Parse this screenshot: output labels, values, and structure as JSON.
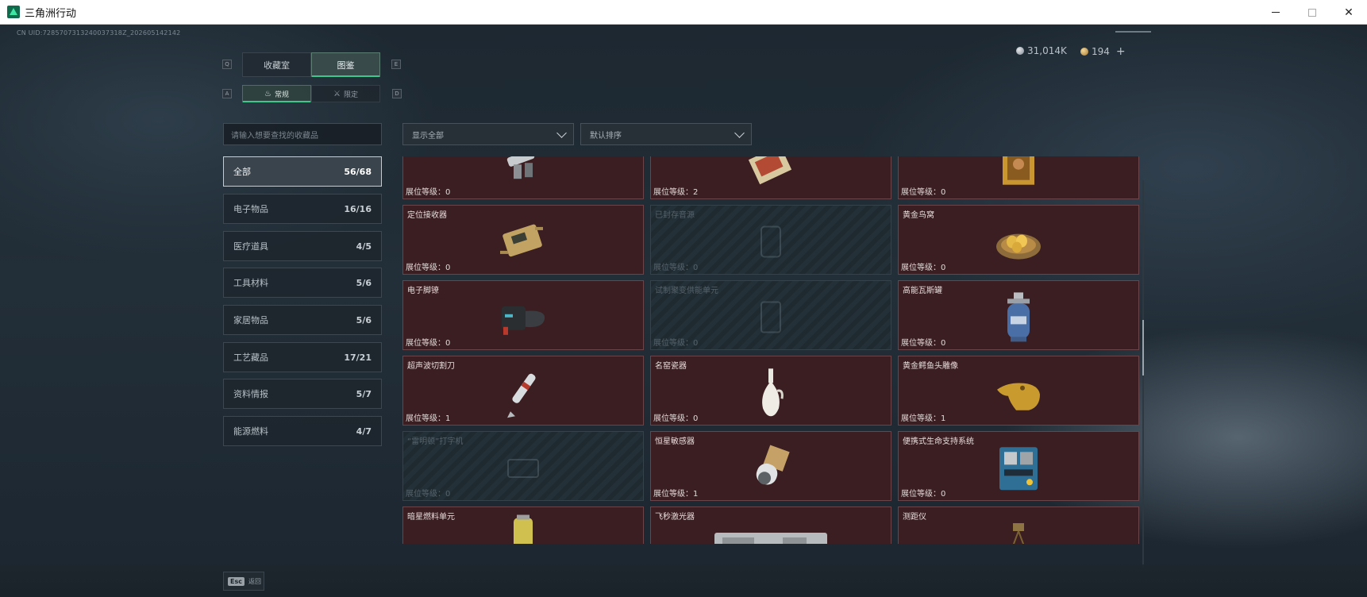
{
  "window": {
    "title": "三角洲行动"
  },
  "uid": "CN UID:7285707313240037318Z_202605142142",
  "currency": {
    "silver": "31,014K",
    "gold": "194",
    "plus": "+"
  },
  "tabs": [
    {
      "label": "收藏室",
      "active": false
    },
    {
      "label": "图鉴",
      "active": true
    }
  ],
  "subtabs": [
    {
      "label": "常规",
      "active": true
    },
    {
      "label": "限定",
      "active": false
    }
  ],
  "key_hints": {
    "tab_left": "Q",
    "tab_right": "E",
    "sub_left": "A",
    "sub_right": "D"
  },
  "search": {
    "placeholder": "请输入想要查找的收藏品"
  },
  "filters": {
    "show": "显示全部",
    "sort": "默认排序"
  },
  "categories": [
    {
      "label": "全部",
      "count": "56/68",
      "active": true
    },
    {
      "label": "电子物品",
      "count": "16/16"
    },
    {
      "label": "医疗道具",
      "count": "4/5"
    },
    {
      "label": "工具材料",
      "count": "5/6"
    },
    {
      "label": "家居物品",
      "count": "5/6"
    },
    {
      "label": "工艺藏品",
      "count": "17/21"
    },
    {
      "label": "资料情报",
      "count": "5/7"
    },
    {
      "label": "能源燃料",
      "count": "4/7"
    }
  ],
  "items": [
    {
      "name": "",
      "level": "展位等级：0",
      "icon": "device-icon",
      "locked": false
    },
    {
      "name": "",
      "level": "展位等级：2",
      "icon": "painting-icon",
      "locked": false
    },
    {
      "name": "",
      "level": "展位等级：0",
      "icon": "gold-frame-icon",
      "locked": false
    },
    {
      "name": "定位接收器",
      "level": "展位等级：0",
      "icon": "receiver-icon",
      "locked": false
    },
    {
      "name": "已封存音源",
      "level": "展位等级：0",
      "icon": "sealed-source-icon",
      "locked": true
    },
    {
      "name": "黄金鸟窝",
      "level": "展位等级：0",
      "icon": "golden-nest-icon",
      "locked": false
    },
    {
      "name": "电子脚镣",
      "level": "展位等级：0",
      "icon": "ankle-monitor-icon",
      "locked": false
    },
    {
      "name": "试制聚变供能单元",
      "level": "展位等级：0",
      "icon": "fusion-unit-icon",
      "locked": true
    },
    {
      "name": "高能瓦斯罐",
      "level": "展位等级：0",
      "icon": "gas-tank-icon",
      "locked": false
    },
    {
      "name": "超声波切割刀",
      "level": "展位等级：1",
      "icon": "ultrasonic-knife-icon",
      "locked": false
    },
    {
      "name": "名窑瓷器",
      "level": "展位等级：0",
      "icon": "porcelain-vase-icon",
      "locked": false
    },
    {
      "name": "黄金鳄鱼头雕像",
      "level": "展位等级：1",
      "icon": "gold-croc-statue-icon",
      "locked": false
    },
    {
      "name": "“雷明顿”打字机",
      "level": "展位等级：0",
      "icon": "typewriter-icon",
      "locked": true
    },
    {
      "name": "恒星敏感器",
      "level": "展位等级：1",
      "icon": "star-sensor-icon",
      "locked": false
    },
    {
      "name": "便携式生命支持系统",
      "level": "展位等级：0",
      "icon": "life-support-icon",
      "locked": false
    },
    {
      "name": "暗星燃料单元",
      "level": "",
      "icon": "fuel-cell-icon",
      "locked": false
    },
    {
      "name": "飞秒激光器",
      "level": "",
      "icon": "femtosecond-laser-icon",
      "locked": false
    },
    {
      "name": "测距仪",
      "level": "",
      "icon": "rangefinder-icon",
      "locked": false
    }
  ],
  "footer": {
    "esc_key": "Esc",
    "esc_label": "返回"
  }
}
